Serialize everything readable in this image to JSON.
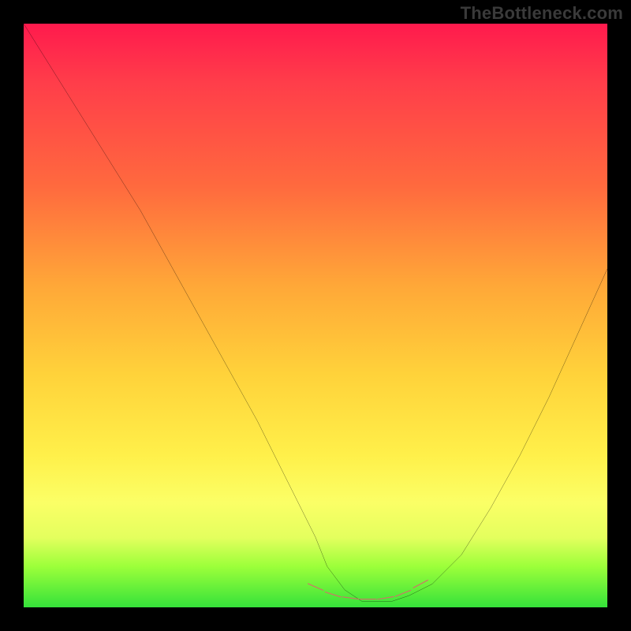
{
  "watermark": "TheBottleneck.com",
  "chart_data": {
    "type": "line",
    "title": "",
    "xlabel": "",
    "ylabel": "",
    "xlim": [
      0,
      100
    ],
    "ylim": [
      0,
      100
    ],
    "series": [
      {
        "name": "curve",
        "x": [
          0,
          5,
          10,
          15,
          20,
          25,
          30,
          35,
          40,
          45,
          50,
          52,
          55,
          58,
          60,
          63,
          66,
          70,
          75,
          80,
          85,
          90,
          95,
          100
        ],
        "y": [
          100,
          92,
          84,
          76,
          68,
          59,
          50,
          41,
          32,
          22,
          12,
          7,
          3,
          1,
          1,
          1,
          2,
          4,
          9,
          17,
          26,
          36,
          47,
          58
        ]
      },
      {
        "name": "bottom-marker-dashes",
        "x": [
          50,
          53,
          56,
          59,
          62,
          65,
          68
        ],
        "y": [
          3.5,
          2.2,
          1.6,
          1.4,
          1.6,
          2.4,
          4.0
        ]
      }
    ],
    "colors": {
      "curve": "#000000",
      "marker": "#d86b6b",
      "gradient_top": "#ff1a4d",
      "gradient_bottom": "#35e23a"
    }
  }
}
